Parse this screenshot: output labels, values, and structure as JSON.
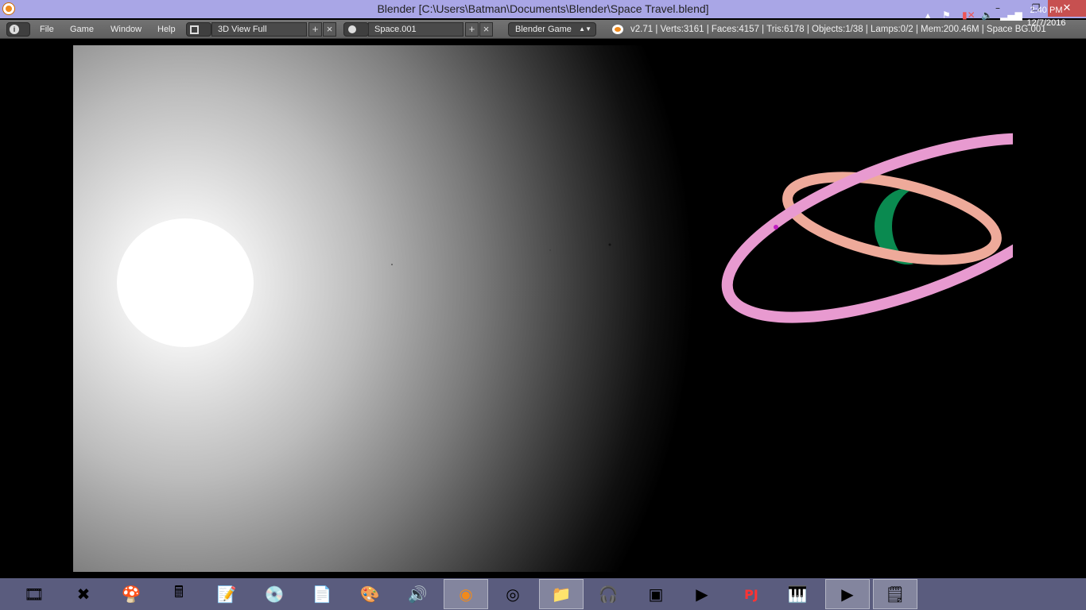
{
  "window": {
    "title": "Blender [C:\\Users\\Batman\\Documents\\Blender\\Space Travel.blend]",
    "minimize": "–",
    "restore": "❐",
    "close": "✕"
  },
  "header": {
    "menus": [
      "File",
      "Game",
      "Window",
      "Help"
    ],
    "screen_layout": "3D View Full",
    "scene": "Space.001",
    "engine": "Blender Game",
    "stats": "v2.71 | Verts:3161 | Faces:4157 | Tris:6178 | Objects:1/38 | Lamps:0/2 | Mem:200.46M | Space BG.001"
  },
  "viewport": {
    "sun_color": "#ffffff",
    "ring_outer_color": "#e89ad0",
    "ring_inner_color": "#eeaa9a",
    "planet_color": "#0a8a50"
  },
  "taskbar": {
    "apps": [
      {
        "name": "movie-maker",
        "glyph": "🎞"
      },
      {
        "name": "app-x",
        "glyph": "✖"
      },
      {
        "name": "mario",
        "glyph": "🍄"
      },
      {
        "name": "calculator",
        "glyph": "🖩"
      },
      {
        "name": "wordpad",
        "glyph": "📝"
      },
      {
        "name": "app-green",
        "glyph": "💿"
      },
      {
        "name": "blank-document",
        "glyph": "📄"
      },
      {
        "name": "photos",
        "glyph": "🎨"
      },
      {
        "name": "speaker",
        "glyph": "🔊"
      },
      {
        "name": "blender",
        "glyph": "◉",
        "active": true
      },
      {
        "name": "chrome",
        "glyph": "◎"
      },
      {
        "name": "file-explorer",
        "glyph": "📁",
        "active": true
      },
      {
        "name": "audacity",
        "glyph": "🎧"
      },
      {
        "name": "app-blue",
        "glyph": "▣"
      },
      {
        "name": "media-player",
        "glyph": "▶"
      },
      {
        "name": "project64",
        "glyph": "PJ"
      },
      {
        "name": "piano",
        "glyph": "🎹"
      },
      {
        "name": "media-player-2",
        "glyph": "▶",
        "active": true
      },
      {
        "name": "notepad",
        "glyph": "🗒",
        "active": true
      }
    ],
    "clock": {
      "time": "2:40 PM",
      "date": "12/7/2016"
    }
  }
}
